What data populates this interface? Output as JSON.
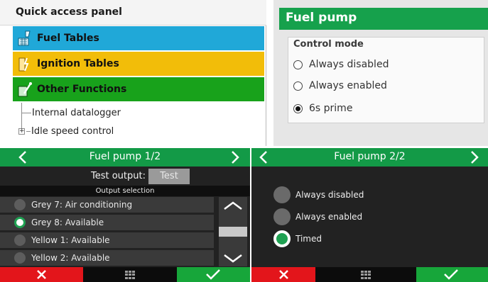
{
  "quick_access": {
    "title": "Quick access panel",
    "buttons": [
      {
        "label": "Fuel Tables",
        "color": "#20a8d8",
        "icon": "fuel-tables-icon"
      },
      {
        "label": "Ignition Tables",
        "color": "#f2bd09",
        "icon": "ignition-tables-icon"
      },
      {
        "label": "Other Functions",
        "color": "#18a21b",
        "icon": "other-functions-icon"
      }
    ],
    "tree": [
      "Internal datalogger",
      "Idle speed control"
    ]
  },
  "fuel_pump": {
    "title": "Fuel pump",
    "group_title": "Control mode",
    "options": [
      "Always disabled",
      "Always enabled",
      "6s prime"
    ],
    "selected_index": 2
  },
  "device1": {
    "title": "Fuel pump 1/2",
    "test_label": "Test output:",
    "test_button": "Test",
    "selection_header": "Output selection",
    "items": [
      "Grey 7: Air conditioning",
      "Grey 8: Available",
      "Yellow 1: Available",
      "Yellow 2: Available"
    ],
    "selected_index": 1
  },
  "device2": {
    "title": "Fuel pump 2/2",
    "options": [
      "Always disabled",
      "Always enabled",
      "Timed"
    ],
    "selected_index": 2
  },
  "colors": {
    "header_green": "#139a47",
    "cancel_red": "#e3151b",
    "confirm_green": "#17a63a"
  }
}
